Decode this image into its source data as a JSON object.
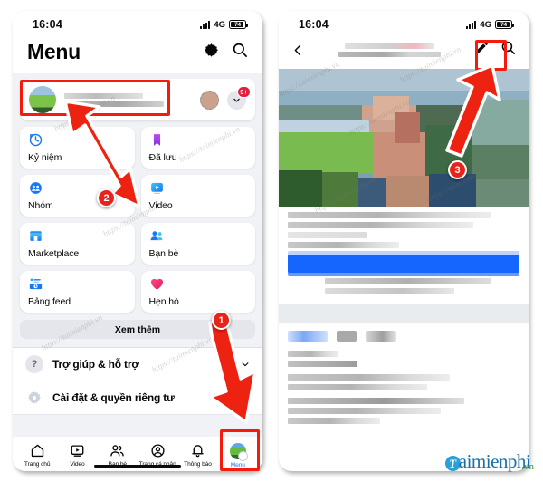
{
  "status_bar": {
    "time": "16:04",
    "network": "4G",
    "battery": "74"
  },
  "left_phone": {
    "header": {
      "title": "Menu",
      "settings_icon": "gear-icon",
      "search_icon": "search-icon"
    },
    "profile": {
      "name_redacted": true,
      "switch_account_icon": "switch-account-icon",
      "expand_icon": "chevron-down-icon",
      "notification_badge": "9+"
    },
    "grid": [
      {
        "label": "Kỷ niệm",
        "icon": "clock-icon",
        "color": "#1877f2"
      },
      {
        "label": "Đã lưu",
        "icon": "bookmark-icon",
        "color": "#a033ff"
      },
      {
        "label": "Nhóm",
        "icon": "groups-icon",
        "color": "#1877f2"
      },
      {
        "label": "Video",
        "icon": "video-icon",
        "color": "#1da6f2"
      },
      {
        "label": "Marketplace",
        "icon": "storefront-icon",
        "color": "#1da6f2"
      },
      {
        "label": "Bạn bè",
        "icon": "friends-icon",
        "color": "#1877f2"
      },
      {
        "label": "Bảng feed",
        "icon": "feeds-icon",
        "color": "#1877f2"
      },
      {
        "label": "Hẹn hò",
        "icon": "heart-icon",
        "color": "#f5317f"
      }
    ],
    "see_more": "Xem thêm",
    "accordions": [
      {
        "label": "Trợ giúp & hỗ trợ",
        "icon": "question-icon",
        "chevron": "chevron-down-icon"
      },
      {
        "label": "Cài đặt & quyền riêng tư",
        "icon": "gear-icon",
        "chevron": "chevron-down-icon"
      }
    ],
    "bottom_nav": [
      {
        "label": "Trang chủ",
        "icon": "home-icon",
        "active": false
      },
      {
        "label": "Video",
        "icon": "video-icon",
        "active": false
      },
      {
        "label": "Bạn bè",
        "icon": "friends-icon",
        "active": false
      },
      {
        "label": "Trang cá nhân",
        "icon": "profile-icon",
        "active": false
      },
      {
        "label": "Thông báo",
        "icon": "bell-icon",
        "active": false
      },
      {
        "label": "Menu",
        "icon": "menu-avatar-icon",
        "active": true
      }
    ]
  },
  "right_phone": {
    "header": {
      "back_icon": "back-chevron-icon",
      "title_redacted": true,
      "edit_icon": "pencil-icon",
      "search_icon": "search-icon"
    },
    "cover_photo_redacted": true,
    "content_redacted": true
  },
  "annotations": {
    "steps": [
      {
        "number": "1",
        "target": "bottom-nav-menu"
      },
      {
        "number": "2",
        "target": "profile-card"
      },
      {
        "number": "3",
        "target": "edit-pencil-icon"
      }
    ],
    "highlight_color": "#f41b0d"
  },
  "watermark": {
    "text": "https://taimienphi.vn",
    "logo_t": "T",
    "logo_main": "aimienphi",
    "logo_tld": ".vn"
  }
}
